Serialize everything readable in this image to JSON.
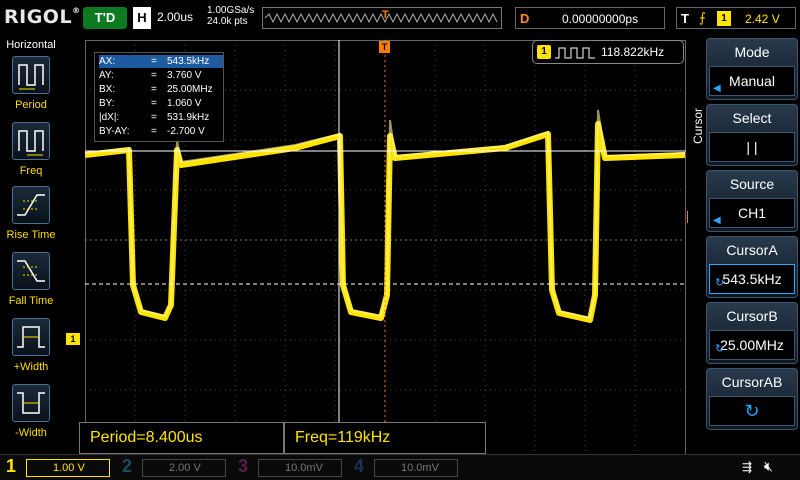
{
  "topbar": {
    "logo": "RIGOL",
    "run_state": "T'D",
    "horizontal_letter": "H",
    "timebase": "2.00us",
    "sample_rate": "1.00GSa/s",
    "memory_depth": "24.0k pts",
    "trigger_position_marker": "T",
    "delay_letter": "D",
    "delay_value": "0.00000000ps",
    "trigger_letter": "T",
    "trigger_slope_icon": "rising-edge-icon",
    "trigger_channel": "1",
    "trigger_level": "2.42 V"
  },
  "left_panel": {
    "title": "Horizontal",
    "items": [
      {
        "label": "Period",
        "icon": "period-icon"
      },
      {
        "label": "Freq",
        "icon": "freq-icon"
      },
      {
        "label": "Rise Time",
        "icon": "rise-time-icon"
      },
      {
        "label": "Fall Time",
        "icon": "fall-time-icon"
      },
      {
        "label": "+Width",
        "icon": "pos-width-icon"
      },
      {
        "label": "-Width",
        "icon": "neg-width-icon"
      }
    ]
  },
  "cursor_readout": {
    "rows": [
      {
        "name": "AX:",
        "eq": "=",
        "value": "543.5kHz",
        "highlight": true
      },
      {
        "name": "AY:",
        "eq": "=",
        "value": "3.760 V",
        "highlight": false
      },
      {
        "name": "BX:",
        "eq": "=",
        "value": "25.00MHz",
        "highlight": false
      },
      {
        "name": "BY:",
        "eq": "=",
        "value": "1.060 V",
        "highlight": false
      },
      {
        "name": "|dX|:",
        "eq": "=",
        "value": "531.9kHz",
        "highlight": false
      },
      {
        "name": "BY-AY:",
        "eq": "=",
        "value": "-2.700 V",
        "highlight": false
      }
    ]
  },
  "freq_counter": {
    "channel": "1",
    "value": "118.822kHz"
  },
  "markers": {
    "ch1": "1",
    "trigger_level": "T",
    "trigger_position": "T"
  },
  "measurements": {
    "period": "Period=8.400us",
    "freq": "Freq=119kHz"
  },
  "right_panel": {
    "side_label": "Cursor",
    "buttons": [
      {
        "title": "Mode",
        "value": "Manual",
        "arrow": true,
        "knob": false
      },
      {
        "title": "Select",
        "value": "|    |",
        "arrow": false,
        "knob": false
      },
      {
        "title": "Source",
        "value": "CH1",
        "arrow": true,
        "knob": false
      },
      {
        "title": "CursorA",
        "value": "543.5kHz",
        "arrow": false,
        "knob": true
      },
      {
        "title": "CursorB",
        "value": "25.00MHz",
        "arrow": false,
        "knob": true
      },
      {
        "title": "CursorAB",
        "value": "↻",
        "arrow": false,
        "knob": false
      }
    ]
  },
  "bottombar": {
    "channels": [
      {
        "num": "1",
        "scale": "1.00 V",
        "color": "#ffe400",
        "active": true
      },
      {
        "num": "2",
        "scale": "2.00 V",
        "color": "#00d2ff",
        "active": false
      },
      {
        "num": "3",
        "scale": "10.0mV",
        "color": "#ff3bd4",
        "active": false
      },
      {
        "num": "4",
        "scale": "10.0mV",
        "color": "#2f6bff",
        "active": false
      }
    ],
    "usb_icon": "usb-icon",
    "speaker_icon": "speaker-muted-icon"
  },
  "colors": {
    "ch1": "#ffe400",
    "trigger": "#ff7d00",
    "accent": "#2aa7ff"
  }
}
